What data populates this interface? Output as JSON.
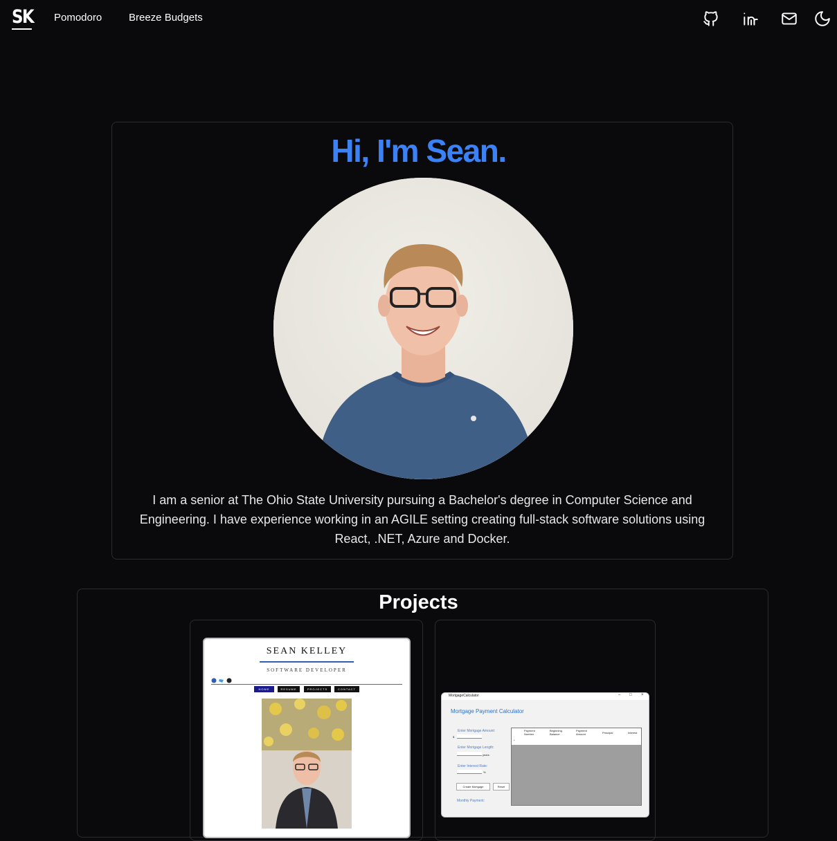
{
  "nav": {
    "logo": "SK",
    "links": [
      "Pomodoro",
      "Breeze Budgets"
    ],
    "icons": [
      "github-icon",
      "linkedin-icon",
      "mail-icon",
      "moon-icon"
    ]
  },
  "hero": {
    "title": "Hi, I'm Sean.",
    "bio": "I am a senior at The Ohio State University pursuing a Bachelor's degree in Computer Science and Engineering. I have experience working in an AGILE setting creating full-stack software solutions using React, .NET, Azure and Docker.",
    "title_color": "#3b82f6"
  },
  "projects": {
    "title": "Projects",
    "portfolio_preview": {
      "name": "SEAN KELLEY",
      "subtitle": "SOFTWARE DEVELOPER",
      "menu": [
        "HOME",
        "RESUME",
        "PROJECTS",
        "CONTACT"
      ]
    },
    "mortgage_preview": {
      "window_title": "MortgageCalculator",
      "heading": "Mortgage Payment Calculator",
      "amount_label": "Enter Mortgage Amount:",
      "currency": "$",
      "length_label": "Enter Mortgage Length:",
      "length_unit": "years",
      "rate_label": "Enter Interest Rate:",
      "rate_unit": "%",
      "create_button": "Create Mortgage",
      "reset_button": "Reset",
      "monthly_label": "Monthly Payment:",
      "columns": [
        "Payment Number",
        "Beginning Balance",
        "Payment Amount",
        "Principal",
        "Interest"
      ],
      "row_marker": "*"
    }
  }
}
